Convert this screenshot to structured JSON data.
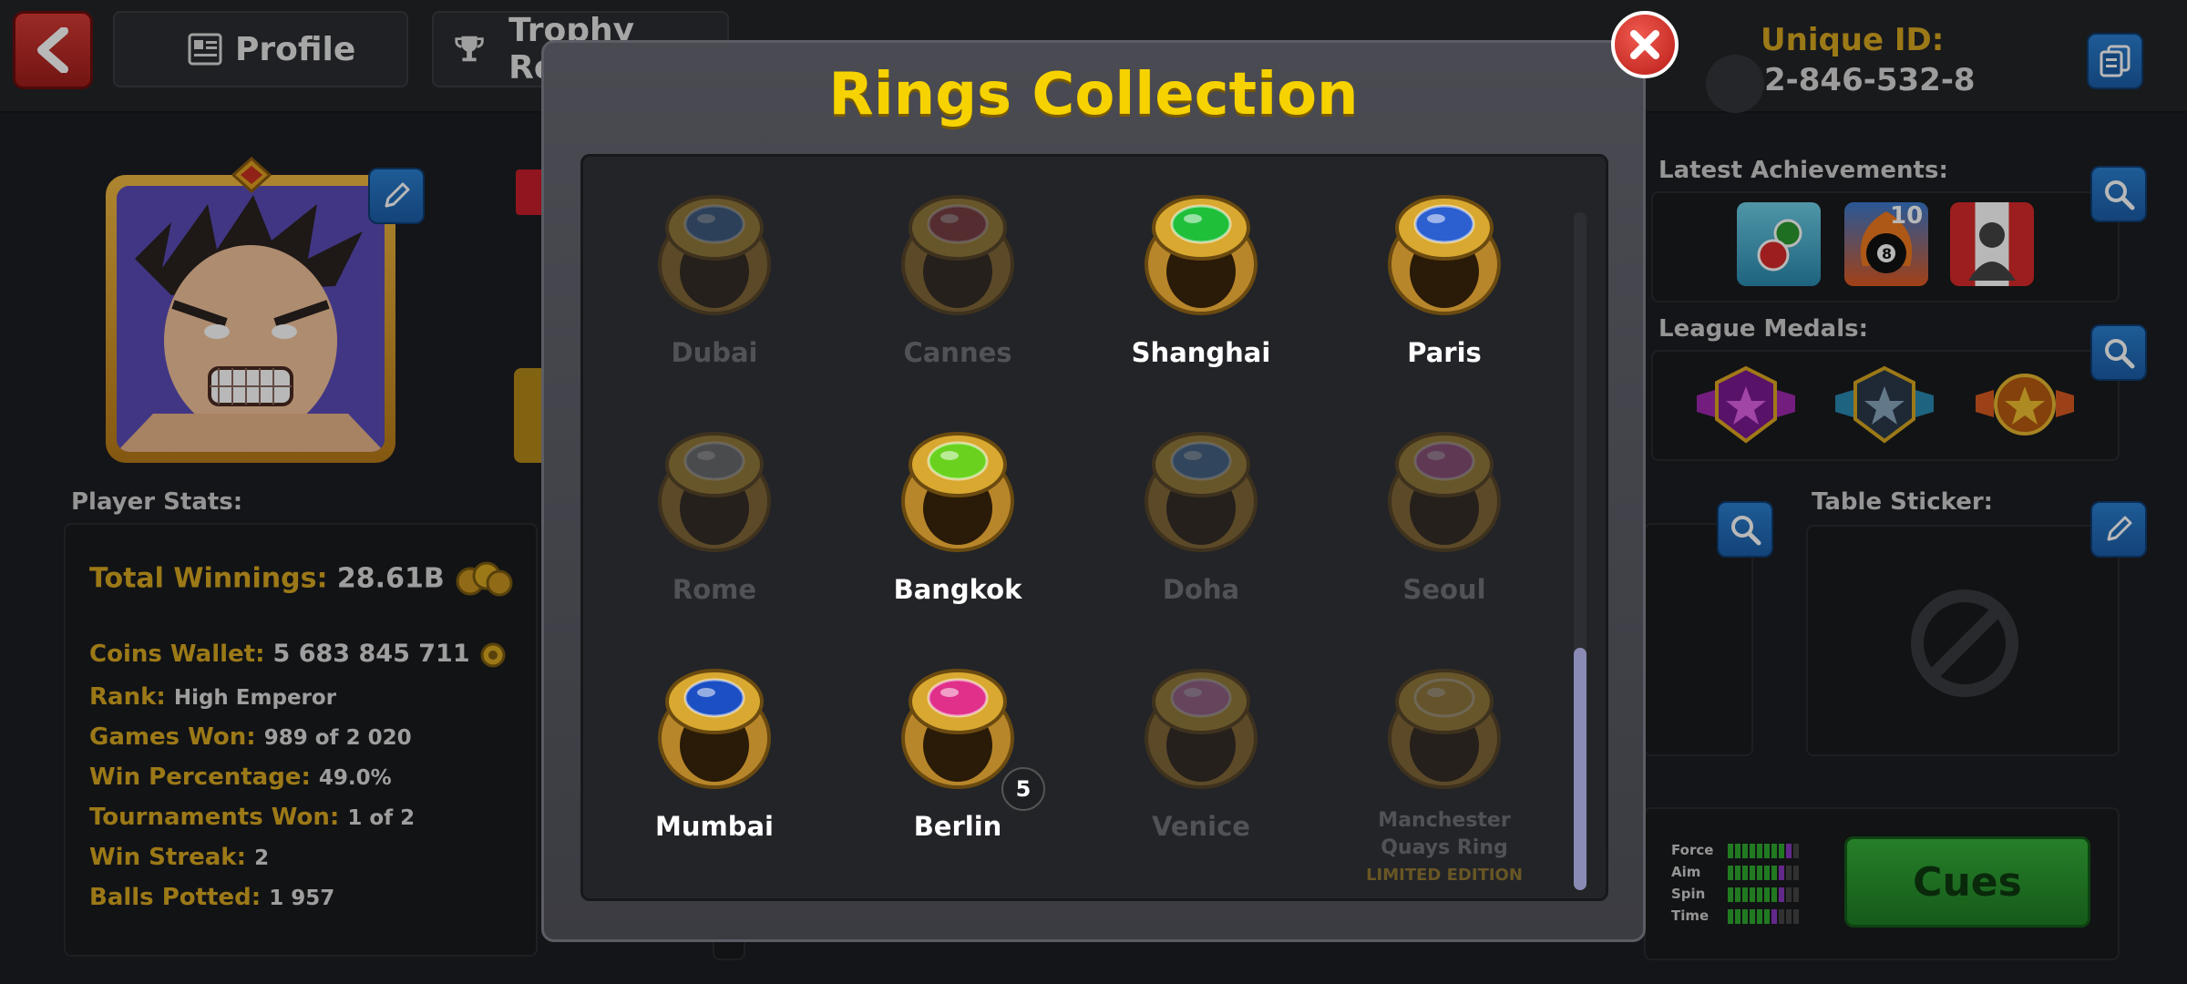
{
  "header": {
    "profile_tab": "Profile",
    "trophy_tab": "Trophy Road",
    "unique_id_label": "Unique ID:",
    "unique_id_value": "2-846-532-8"
  },
  "sections": {
    "latest_achievements": "Latest Achievements:",
    "league_medals": "League Medals:",
    "table_sticker": "Table Sticker:",
    "player_stats": "Player Stats:"
  },
  "stats": {
    "total_winnings_label": "Total Winnings:",
    "total_winnings_value": "28.61B",
    "coins_wallet_label": "Coins Wallet:",
    "coins_wallet_value": "5 683 845 711",
    "rank_label": "Rank:",
    "rank_value": "High Emperor",
    "games_won_label": "Games Won:",
    "games_won_value": "989 of 2 020",
    "win_percentage_label": "Win Percentage:",
    "win_percentage_value": "49.0%",
    "tournaments_won_label": "Tournaments Won:",
    "tournaments_won_value": "1 of 2",
    "win_streak_label": "Win Streak:",
    "win_streak_value": "2",
    "balls_potted_label": "Balls Potted:",
    "balls_potted_value": "1 957"
  },
  "achievements": {
    "badge_count": "10"
  },
  "modal": {
    "title": "Rings Collection",
    "rings": [
      {
        "name": "Dubai",
        "owned": false,
        "color": "#3b6fa8"
      },
      {
        "name": "Cannes",
        "owned": false,
        "color": "#a83b3b"
      },
      {
        "name": "Shanghai",
        "owned": true,
        "color": "#1fbf3a"
      },
      {
        "name": "Paris",
        "owned": true,
        "color": "#2c5fd0"
      },
      {
        "name": "Rome",
        "owned": false,
        "color": "#8a8a8a"
      },
      {
        "name": "Bangkok",
        "owned": true,
        "color": "#6ad21e"
      },
      {
        "name": "Doha",
        "owned": false,
        "color": "#4a7fb0"
      },
      {
        "name": "Seoul",
        "owned": false,
        "color": "#c05a9a"
      },
      {
        "name": "Mumbai",
        "owned": true,
        "color": "#1c4fc4"
      },
      {
        "name": "Berlin",
        "owned": true,
        "color": "#e0308a",
        "count": "5"
      },
      {
        "name": "Venice",
        "owned": false,
        "color": "#d07ab0"
      },
      {
        "name": "Manchester\nQuays Ring",
        "owned": false,
        "color": "#d0a030",
        "edition": "LIMITED EDITION"
      }
    ]
  },
  "cue_stats": {
    "force_label": "Force",
    "force_level": 0.9,
    "aim_label": "Aim",
    "aim_level": 0.8,
    "spin_label": "Spin",
    "spin_level": 0.8,
    "time_label": "Time",
    "time_level": 0.7
  },
  "buttons": {
    "cues": "Cues"
  },
  "colors": {
    "accent_gold": "#d8a820",
    "title_yellow": "#f6d200",
    "close_red": "#d8312a",
    "button_blue": "#2169b8",
    "cues_green": "#2a9a2e"
  }
}
